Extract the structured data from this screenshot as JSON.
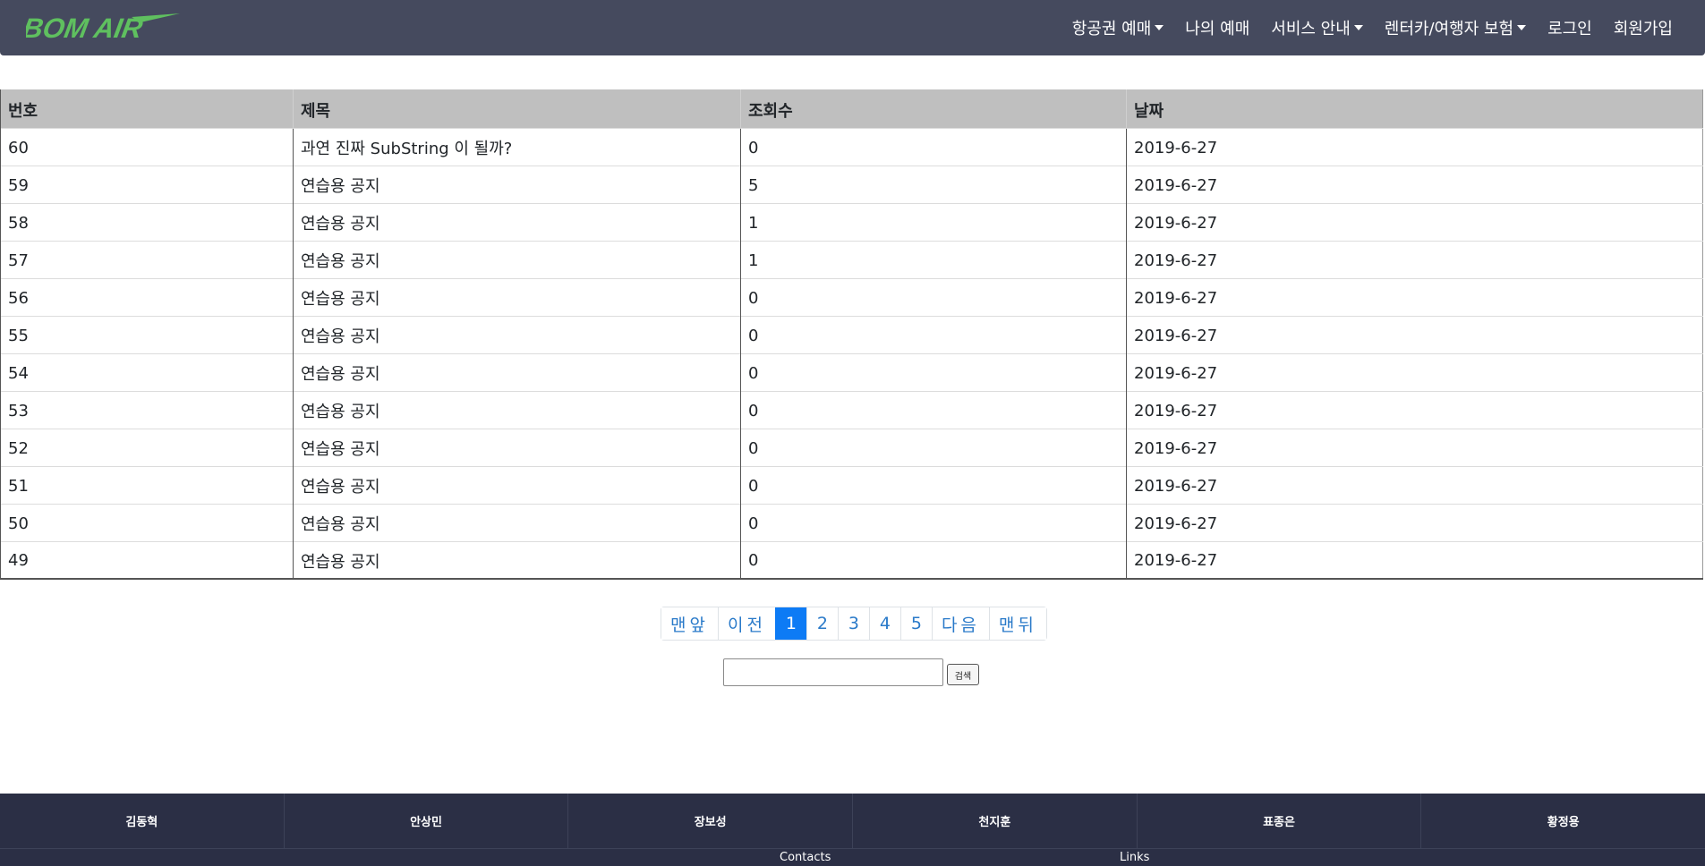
{
  "brand": {
    "logo_text": "BOM AIR",
    "logo_color": "#5fc05f"
  },
  "nav": {
    "items": [
      {
        "label": "항공권 예매",
        "dropdown": true
      },
      {
        "label": "나의 예매",
        "dropdown": false
      },
      {
        "label": "서비스 안내",
        "dropdown": true
      },
      {
        "label": "렌터카/여행자 보험",
        "dropdown": true
      },
      {
        "label": "로그인",
        "dropdown": false
      },
      {
        "label": "회원가입",
        "dropdown": false
      }
    ]
  },
  "table": {
    "headers": [
      "번호",
      "제목",
      "조회수",
      "날짜"
    ],
    "rows": [
      [
        "60",
        "과연 진짜 SubString 이 될까?",
        "0",
        "2019-6-27"
      ],
      [
        "59",
        "연습용 공지",
        "5",
        "2019-6-27"
      ],
      [
        "58",
        "연습용 공지",
        "1",
        "2019-6-27"
      ],
      [
        "57",
        "연습용 공지",
        "1",
        "2019-6-27"
      ],
      [
        "56",
        "연습용 공지",
        "0",
        "2019-6-27"
      ],
      [
        "55",
        "연습용 공지",
        "0",
        "2019-6-27"
      ],
      [
        "54",
        "연습용 공지",
        "0",
        "2019-6-27"
      ],
      [
        "53",
        "연습용 공지",
        "0",
        "2019-6-27"
      ],
      [
        "52",
        "연습용 공지",
        "0",
        "2019-6-27"
      ],
      [
        "51",
        "연습용 공지",
        "0",
        "2019-6-27"
      ],
      [
        "50",
        "연습용 공지",
        "0",
        "2019-6-27"
      ],
      [
        "49",
        "연습용 공지",
        "0",
        "2019-6-27"
      ]
    ]
  },
  "pagination": {
    "first": "맨앞",
    "prev": "이전",
    "pages": [
      "1",
      "2",
      "3",
      "4",
      "5"
    ],
    "current": "1",
    "next": "다음",
    "last": "맨뒤"
  },
  "search": {
    "value": "",
    "button_label": "검색"
  },
  "footer": {
    "names": [
      "김동혁",
      "안상민",
      "장보성",
      "천지훈",
      "표종은",
      "황정용"
    ],
    "contacts_label": "Contacts",
    "links_label": "Links"
  }
}
